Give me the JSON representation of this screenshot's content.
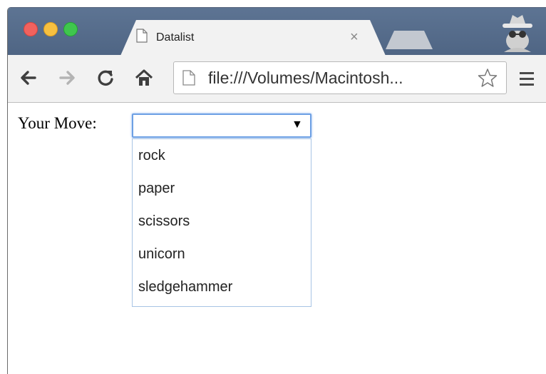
{
  "tab": {
    "title": "Datalist",
    "close": "×"
  },
  "address_bar": {
    "url": "file:///Volumes/Macintosh..."
  },
  "form": {
    "label": "Your Move:",
    "input_value": "",
    "dropdown_arrow": "▼",
    "options": [
      "rock",
      "paper",
      "scissors",
      "unicorn",
      "sledgehammer"
    ]
  },
  "icons": {
    "back": "arrow-left-icon",
    "forward": "arrow-right-icon",
    "reload": "reload-icon",
    "home": "home-icon",
    "bookmark": "star-icon",
    "menu": "hamburger-menu-icon",
    "incognito": "incognito-icon"
  },
  "colors": {
    "tabstrip": "#5d7493",
    "toolbar": "#f2f2f2",
    "focus_ring": "#6da0e4",
    "close_light": "#f1625e",
    "minimize_light": "#f7c040",
    "maximize_light": "#3fc64d"
  }
}
